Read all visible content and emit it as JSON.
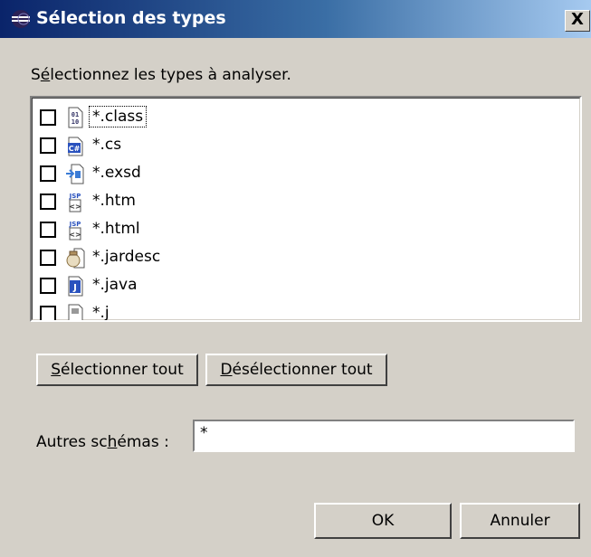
{
  "window": {
    "title": "Sélection des types",
    "close_glyph": "X",
    "icon": "eclipse-icon"
  },
  "prompt": {
    "pre": "S",
    "mnemonic": "é",
    "post": "lectionnez les types à analyser."
  },
  "types": [
    {
      "label": "*.class",
      "checked": false,
      "icon": "class-file-icon",
      "icon_text": "01\n10"
    },
    {
      "label": "*.cs",
      "checked": false,
      "icon": "csharp-file-icon",
      "icon_text": "C#"
    },
    {
      "label": "*.exsd",
      "checked": false,
      "icon": "exsd-file-icon",
      "icon_text": "⇒"
    },
    {
      "label": "*.htm",
      "checked": false,
      "icon": "jsp-file-icon",
      "icon_text": "JSP"
    },
    {
      "label": "*.html",
      "checked": false,
      "icon": "jsp-file-icon",
      "icon_text": "JSP"
    },
    {
      "label": "*.jardesc",
      "checked": false,
      "icon": "jar-file-icon",
      "icon_text": "⚱"
    },
    {
      "label": "*.java",
      "checked": false,
      "icon": "java-file-icon",
      "icon_text": "J"
    },
    {
      "label": "*.j",
      "checked": false,
      "icon": "file-icon",
      "icon_text": ""
    }
  ],
  "buttons": {
    "select_all": {
      "mnemonic": "S",
      "rest": "électionner tout"
    },
    "deselect_all": {
      "mnemonic": "D",
      "rest": "ésélectionner tout"
    },
    "ok": "OK",
    "cancel": "Annuler"
  },
  "other_patterns": {
    "label_pre": "Autres sc",
    "label_mnemonic": "h",
    "label_post": "émas :",
    "value": "*"
  }
}
